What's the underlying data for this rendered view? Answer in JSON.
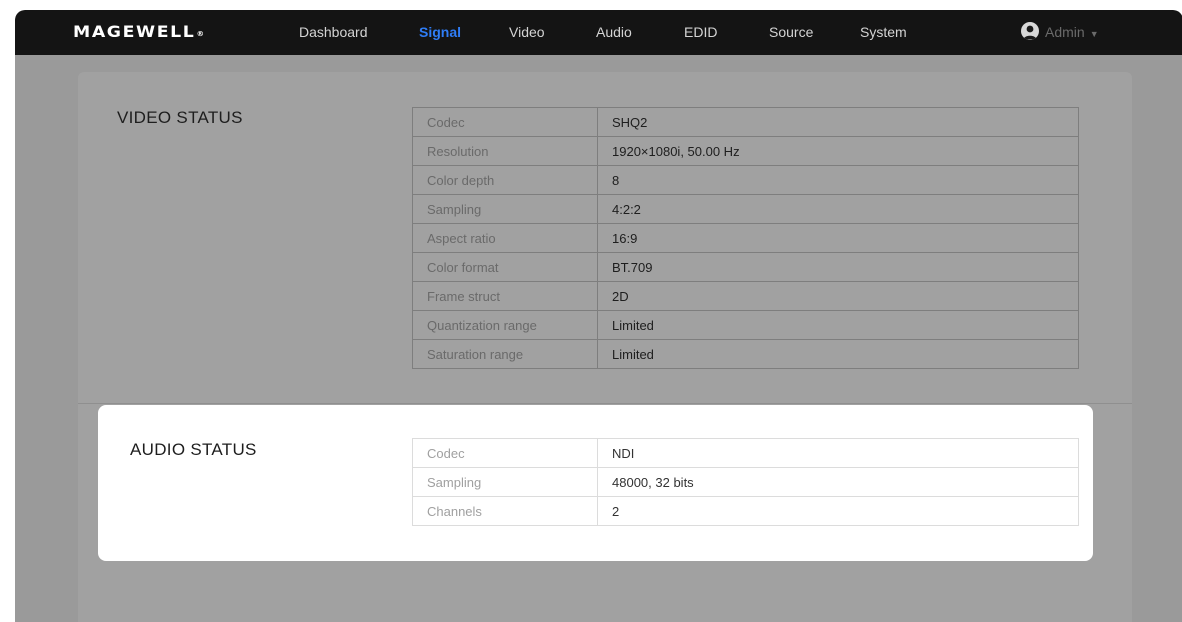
{
  "brand": {
    "logo_text": "MAGEWELL",
    "logo_mark": "®"
  },
  "nav": {
    "items": [
      {
        "label": "Dashboard",
        "active": false
      },
      {
        "label": "Signal",
        "active": true
      },
      {
        "label": "Video",
        "active": false
      },
      {
        "label": "Audio",
        "active": false
      },
      {
        "label": "EDID",
        "active": false
      },
      {
        "label": "Source",
        "active": false
      },
      {
        "label": "System",
        "active": false
      }
    ],
    "active_color": "#2f7df6"
  },
  "user": {
    "name": "Admin",
    "icon": "user-avatar-icon",
    "dropdown_icon": "caret-down-icon"
  },
  "video_status": {
    "title": "VIDEO STATUS",
    "rows": [
      {
        "key": "Codec",
        "value": "SHQ2"
      },
      {
        "key": "Resolution",
        "value": "1920×1080i, 50.00 Hz"
      },
      {
        "key": "Color depth",
        "value": "8"
      },
      {
        "key": "Sampling",
        "value": "4:2:2"
      },
      {
        "key": "Aspect ratio",
        "value": "16:9"
      },
      {
        "key": "Color format",
        "value": "BT.709"
      },
      {
        "key": "Frame struct",
        "value": "2D"
      },
      {
        "key": "Quantization range",
        "value": "Limited"
      },
      {
        "key": "Saturation range",
        "value": "Limited"
      }
    ]
  },
  "audio_status": {
    "title": "AUDIO STATUS",
    "rows": [
      {
        "key": "Codec",
        "value": "NDI"
      },
      {
        "key": "Sampling",
        "value": "48000, 32 bits"
      },
      {
        "key": "Channels",
        "value": "2"
      }
    ]
  }
}
